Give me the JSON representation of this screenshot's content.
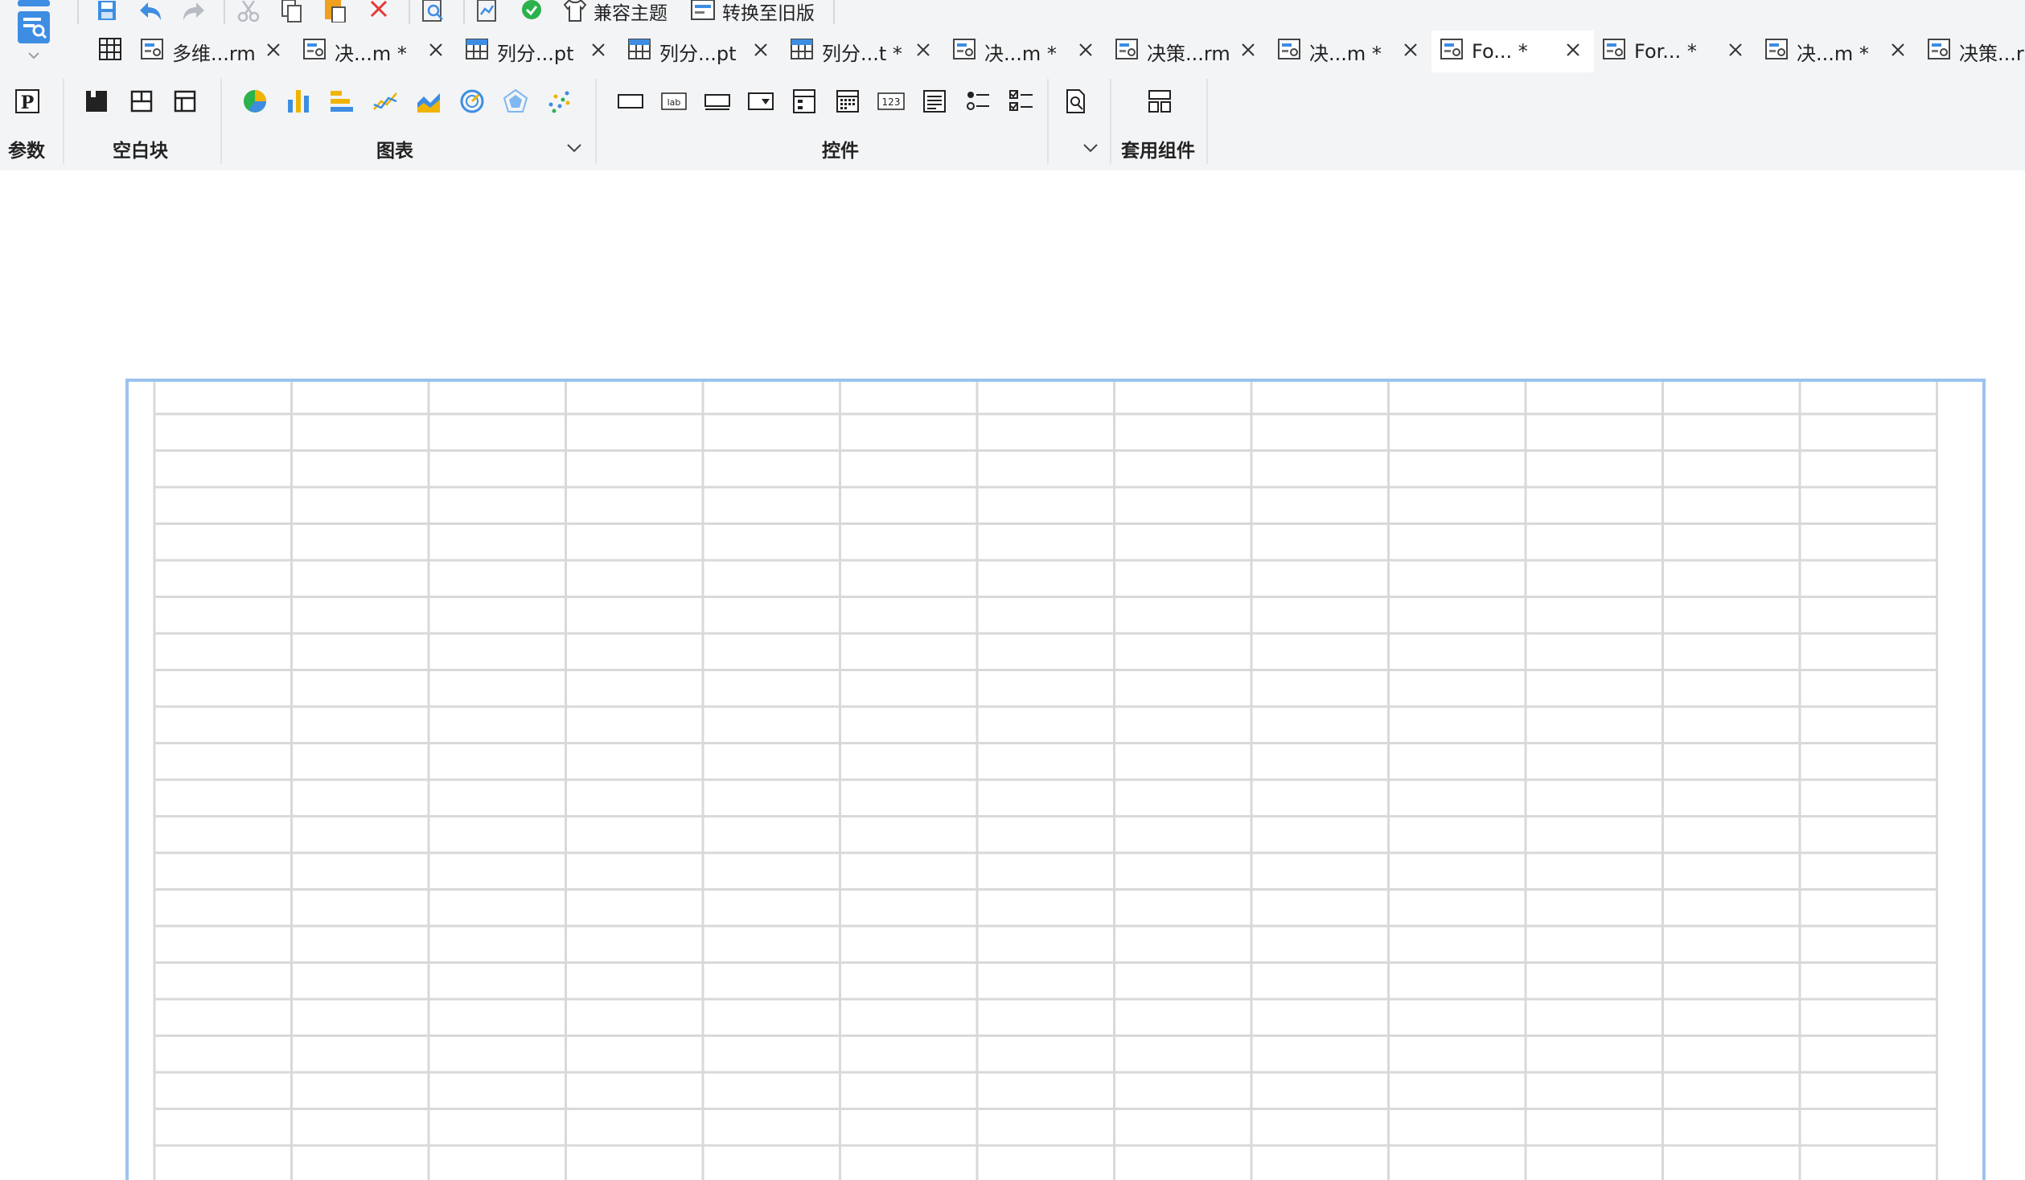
{
  "toolbar": {
    "buttons": [
      {
        "name": "save-icon"
      },
      {
        "name": "undo-icon"
      },
      {
        "name": "redo-icon"
      },
      {
        "name": "cut-icon"
      },
      {
        "name": "copy-icon"
      },
      {
        "name": "paste-icon"
      },
      {
        "name": "delete-icon"
      },
      {
        "name": "preview-icon"
      },
      {
        "name": "debug-preview-icon"
      },
      {
        "name": "check-icon"
      }
    ],
    "theme_label": "兼容主题",
    "convert_label": "转换至旧版"
  },
  "tabs": [
    {
      "label": "",
      "kind": "grid",
      "closable": false,
      "active": false
    },
    {
      "label": "多维...rm",
      "kind": "form",
      "closable": true,
      "active": false
    },
    {
      "label": "决...m *",
      "kind": "form",
      "closable": true,
      "active": false
    },
    {
      "label": "列分...pt",
      "kind": "report",
      "closable": true,
      "active": false
    },
    {
      "label": "列分...pt",
      "kind": "report",
      "closable": true,
      "active": false
    },
    {
      "label": "列分...t *",
      "kind": "report",
      "closable": true,
      "active": false
    },
    {
      "label": "决...m *",
      "kind": "form",
      "closable": true,
      "active": false
    },
    {
      "label": "决策...rm",
      "kind": "form",
      "closable": true,
      "active": false
    },
    {
      "label": "决...m *",
      "kind": "form",
      "closable": true,
      "active": false
    },
    {
      "label": "Fo... *",
      "kind": "form",
      "closable": true,
      "active": true
    },
    {
      "label": "For... *",
      "kind": "form",
      "closable": true,
      "active": false
    },
    {
      "label": "决...m *",
      "kind": "form",
      "closable": true,
      "active": false
    },
    {
      "label": "决策...r",
      "kind": "form",
      "closable": false,
      "active": false
    }
  ],
  "ribbon": {
    "params_label": "参数",
    "blank_label": "空白块",
    "chart_label": "图表",
    "widget_label": "控件",
    "component_label": "套用组件",
    "params_icons": [
      "parameter-icon"
    ],
    "blank_icons": [
      "absolute-block-icon",
      "split-block-icon",
      "tab-block-icon"
    ],
    "chart_icons": [
      "pie-chart-icon",
      "bar-chart-icon",
      "horizontal-bar-chart-icon",
      "line-chart-icon",
      "area-chart-icon",
      "gauge-chart-icon",
      "radar-chart-icon",
      "scatter-chart-icon"
    ],
    "widget_icons": [
      "button-widget-icon",
      "label-widget-icon",
      "text-field-widget-icon",
      "dropdown-widget-icon",
      "dropdown-tree-widget-icon",
      "date-widget-icon",
      "number-widget-icon",
      "textarea-widget-icon",
      "radio-group-widget-icon",
      "checkbox-group-widget-icon",
      "file-widget-icon"
    ],
    "component_icons": [
      "layout-component-icon"
    ]
  },
  "colors": {
    "chrome_bg": "#f3f4f6",
    "accent": "#3d8ee3",
    "frame_border": "#9cc3ee",
    "grid_line": "#d9d9d9",
    "close_red": "#e53935",
    "check_green": "#2bb24c"
  },
  "grid": {
    "columns": 13,
    "rows": 22
  }
}
